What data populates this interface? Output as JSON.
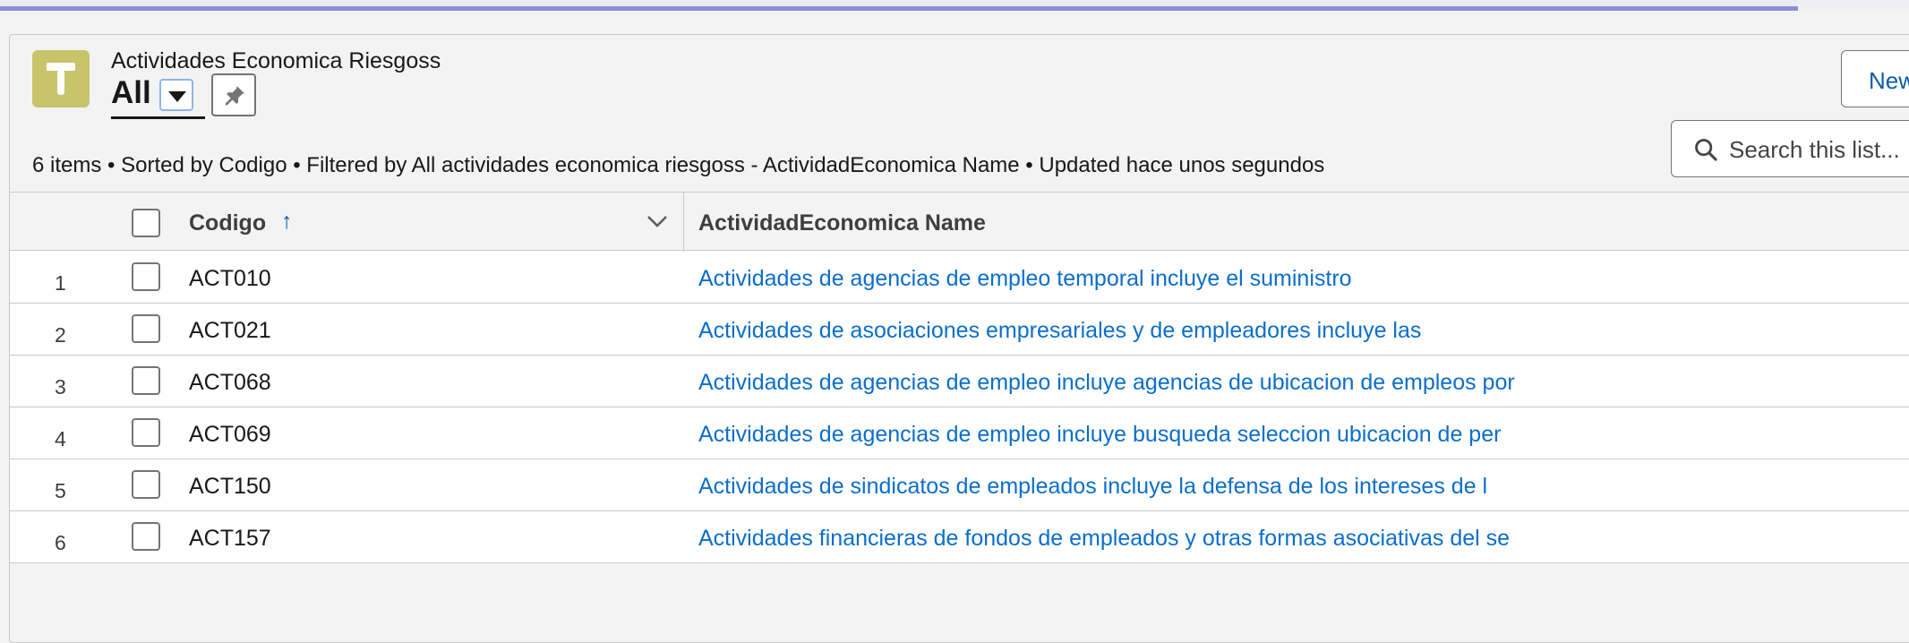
{
  "object": {
    "label": "Actividades Economica Riesgoss",
    "icon": "hammer-icon",
    "icon_color": "#c8c46a"
  },
  "view": {
    "name": "All",
    "dropdown_icon": "triangle-down-icon",
    "pin_icon": "pin-icon"
  },
  "actions": {
    "new_label": "New"
  },
  "search": {
    "placeholder": "Search this list...",
    "icon": "search-icon"
  },
  "meta": {
    "summary": "6 items • Sorted by Codigo • Filtered by All actividades economica riesgoss - ActividadEconomica Name • Updated hace unos segundos"
  },
  "table": {
    "columns": {
      "codigo": "Codigo",
      "sort_indicator": "↑",
      "name": "ActividadEconomica Name"
    },
    "rows": [
      {
        "num": "1",
        "codigo": "ACT010",
        "name": "Actividades de agencias de empleo temporal incluye el suministro"
      },
      {
        "num": "2",
        "codigo": "ACT021",
        "name": "Actividades de asociaciones empresariales y de empleadores incluye las"
      },
      {
        "num": "3",
        "codigo": "ACT068",
        "name": "Actividades de agencias de empleo incluye agencias de ubicacion de empleos por"
      },
      {
        "num": "4",
        "codigo": "ACT069",
        "name": "Actividades de agencias de empleo incluye busqueda seleccion ubicacion de per"
      },
      {
        "num": "5",
        "codigo": "ACT150",
        "name": "Actividades de sindicatos de empleados incluye la defensa de los intereses de l"
      },
      {
        "num": "6",
        "codigo": "ACT157",
        "name": "Actividades financieras de fondos de empleados y otras formas asociativas del se"
      }
    ]
  },
  "colors": {
    "link": "#0b6ecb",
    "brand_blue": "#0b5cab",
    "top_accent": "#8b8fd9"
  }
}
